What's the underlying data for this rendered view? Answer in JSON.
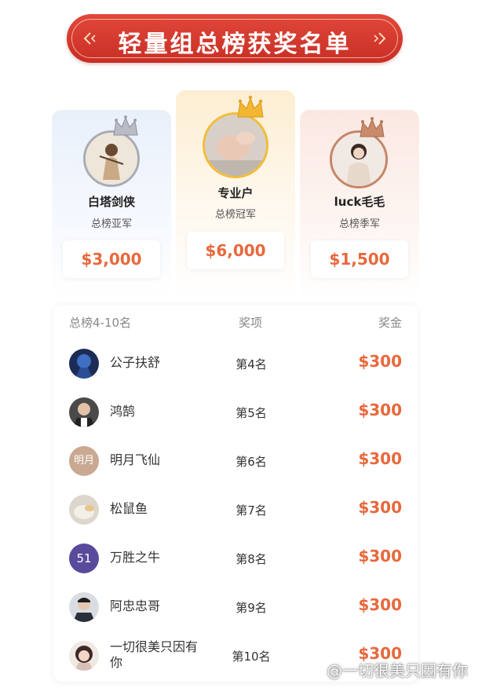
{
  "banner": {
    "title": "轻量组总榜获奖名单"
  },
  "podium": {
    "first": {
      "name": "专业户",
      "rank_label": "总榜冠军",
      "prize": "$6,000",
      "crown_color": "#f2b632"
    },
    "second": {
      "name": "白塔剑侠",
      "rank_label": "总榜亚军",
      "prize": "$3,000",
      "crown_color": "#b9bcc4"
    },
    "third": {
      "name": "luck毛毛",
      "rank_label": "总榜季军",
      "prize": "$1,500",
      "crown_color": "#c98b6a"
    }
  },
  "list": {
    "headers": {
      "rank_group": "总榜4-10名",
      "award": "奖项",
      "prize": "奖金"
    },
    "rows": [
      {
        "name": "公子扶舒",
        "rank": "第4名",
        "prize": "$300"
      },
      {
        "name": "鸿鹄",
        "rank": "第5名",
        "prize": "$300"
      },
      {
        "name": "明月飞仙",
        "rank": "第6名",
        "prize": "$300",
        "avatar_text": "明月"
      },
      {
        "name": "松鼠鱼",
        "rank": "第7名",
        "prize": "$300"
      },
      {
        "name": "万胜之牛",
        "rank": "第8名",
        "prize": "$300",
        "avatar_text": "51"
      },
      {
        "name": "阿忠忠哥",
        "rank": "第9名",
        "prize": "$300"
      },
      {
        "name": "一切很美只因有你",
        "rank": "第10名",
        "prize": "$300"
      }
    ]
  },
  "watermark": {
    "text": "@一切很美只因有你"
  },
  "colors": {
    "accent": "#e8683c",
    "banner": "#d2382c"
  }
}
